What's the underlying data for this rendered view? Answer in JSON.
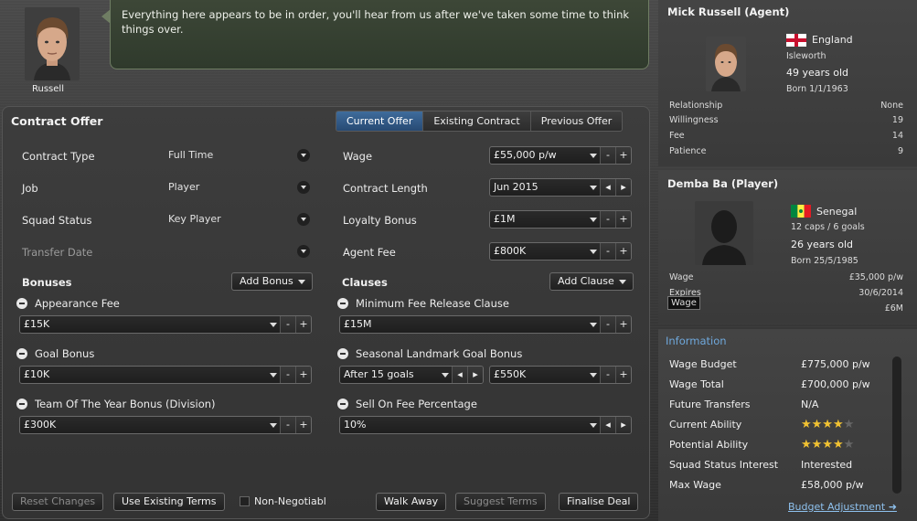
{
  "agent_portrait": {
    "name": "Russell"
  },
  "message": "Everything here appears to be in order, you'll hear from us after we've taken some time to think things over.",
  "offer": {
    "title": "Contract Offer",
    "tabs": [
      {
        "label": "Current Offer",
        "active": true
      },
      {
        "label": "Existing Contract",
        "active": false
      },
      {
        "label": "Previous Offer",
        "active": false
      }
    ],
    "left_fields": [
      {
        "label": "Contract Type",
        "value": "Full Time"
      },
      {
        "label": "Job",
        "value": "Player"
      },
      {
        "label": "Squad Status",
        "value": "Key Player"
      },
      {
        "label": "Transfer Date",
        "value": ""
      }
    ],
    "right_fields": [
      {
        "label": "Wage",
        "value": "£55,000 p/w"
      },
      {
        "label": "Contract Length",
        "value": "Jun 2015"
      },
      {
        "label": "Loyalty Bonus",
        "value": "£1M"
      },
      {
        "label": "Agent Fee",
        "value": "£800K"
      }
    ],
    "bonuses": {
      "header": "Bonuses",
      "add_label": "Add Bonus",
      "items": [
        {
          "label": "Appearance Fee",
          "value": "£15K"
        },
        {
          "label": "Goal Bonus",
          "value": "£10K"
        },
        {
          "label": "Team Of The Year Bonus (Division)",
          "value": "£300K"
        }
      ]
    },
    "clauses": {
      "header": "Clauses",
      "add_label": "Add Clause",
      "items": [
        {
          "label": "Minimum Fee Release Clause",
          "value": "£15M"
        },
        {
          "label": "Seasonal Landmark Goal Bonus",
          "value": "After 15 goals",
          "value2": "£550K"
        },
        {
          "label": "Sell On Fee Percentage",
          "value": "10%"
        }
      ]
    },
    "footer": {
      "reset": "Reset Changes",
      "use_existing": "Use Existing Terms",
      "non_negotiable": "Non-Negotiabl",
      "walk_away": "Walk Away",
      "suggest": "Suggest Terms",
      "finalise": "Finalise Deal"
    },
    "btn_minus": "-",
    "btn_plus": "+",
    "btn_prev": "◂",
    "btn_next": "▸"
  },
  "agent": {
    "title": "Mick Russell (Agent)",
    "nation": "England",
    "town": "Isleworth",
    "age": "49 years old",
    "born": "Born 1/1/1963",
    "stats": [
      {
        "label": "Relationship",
        "value": "None"
      },
      {
        "label": "Willingness",
        "value": "19"
      },
      {
        "label": "Fee",
        "value": "14"
      },
      {
        "label": "Patience",
        "value": "9"
      }
    ]
  },
  "player": {
    "title": "Demba Ba (Player)",
    "nation": "Senegal",
    "caps": "12 caps / 6 goals",
    "age": "26 years old",
    "born": "Born 25/5/1985",
    "stats": [
      {
        "label": "Wage",
        "value": "£35,000 p/w"
      },
      {
        "label": "Expires",
        "value": "30/6/2014"
      },
      {
        "label": "Wage",
        "value": "£6M"
      }
    ]
  },
  "information": {
    "title": "Information",
    "rows": [
      {
        "label": "Wage Budget",
        "value": "£775,000 p/w"
      },
      {
        "label": "Wage Total",
        "value": "£700,000 p/w"
      },
      {
        "label": "Future Transfers",
        "value": "N/A"
      },
      {
        "label": "Current Ability",
        "stars": "★★★★",
        "stars_off": "★",
        "stars_value": 4,
        "stars_max": 5
      },
      {
        "label": "Potential Ability",
        "stars": "★★★★",
        "stars_off": "★",
        "stars_value": 4,
        "stars_max": 5
      },
      {
        "label": "Squad Status Interest",
        "value": "Interested"
      },
      {
        "label": "Max Wage",
        "value": "£58,000 p/w"
      }
    ],
    "link": "Budget Adjustment ➜"
  },
  "colors": {
    "accent": "#3f6c9c",
    "link": "#8ec1ee",
    "star": "#f1c232"
  }
}
